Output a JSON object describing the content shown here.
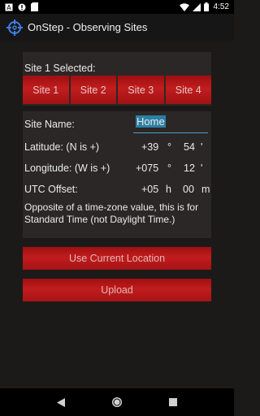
{
  "status_bar": {
    "time": "4:52",
    "left_icons": [
      "notification-a-icon",
      "alert-circle-icon",
      "sd-card-icon"
    ],
    "right_icons": [
      "wifi-icon",
      "signal-icon",
      "battery-icon"
    ]
  },
  "app_bar": {
    "title": "OnStep - Observing Sites",
    "icon": "telescope-reticle-icon"
  },
  "site_selector": {
    "selected_label": "Site 1 Selected:",
    "tabs": [
      "Site 1",
      "Site 2",
      "Site 3",
      "Site 4"
    ]
  },
  "site_form": {
    "name_label": "Site Name:",
    "name_value": "Home",
    "latitude_label": "Latitude: (N is +)",
    "latitude_deg": "+39",
    "latitude_deg_unit": "°",
    "latitude_min": "54",
    "latitude_min_unit": "'",
    "longitude_label": "Longitude: (W is +)",
    "longitude_deg": "+075",
    "longitude_deg_unit": "°",
    "longitude_min": "12",
    "longitude_min_unit": "'",
    "utc_label": "UTC Offset:",
    "utc_hours": "+05",
    "utc_hours_unit": "h",
    "utc_minutes": "00",
    "utc_minutes_unit": "m",
    "note": "Opposite of a time-zone value, this is for Standard Time (not Daylight Time.)"
  },
  "actions": {
    "use_location": "Use Current Location",
    "upload": "Upload"
  },
  "colors": {
    "accent_red": "#c11c1d",
    "panel": "#2b2727",
    "background": "#1c1a19",
    "input_highlight": "#2d7fa3"
  }
}
